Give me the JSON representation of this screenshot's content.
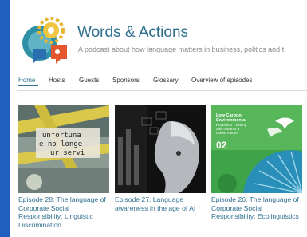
{
  "site": {
    "title": "Words & Actions",
    "tagline": "A podcast about how language matters in business, politics and t"
  },
  "nav": {
    "items": [
      "Home",
      "Hosts",
      "Guests",
      "Sponsors",
      "Glossary",
      "Overview of episodes"
    ],
    "active": "Home"
  },
  "episodes": [
    {
      "title": "Episode 28: The language of Corporate Social Responsibility: Linguistic Discrimination",
      "image_text": [
        "unfortuna",
        "e no longe",
        "ur servi"
      ]
    },
    {
      "title": "Episode 27: Language awareness in the age of AI"
    },
    {
      "title": "Episode 26: The language of Corporate Social Responsibility: Ecolinguistics",
      "image_text": [
        "Low Carbon",
        "Environmental",
        "Protection · Setting",
        "Sail Towards a",
        "Green Future"
      ],
      "image_number": "02"
    }
  ],
  "colors": {
    "frame": "#1f5fbf",
    "accent": "#2f6f8f",
    "eco_green": "#3fa34a"
  }
}
